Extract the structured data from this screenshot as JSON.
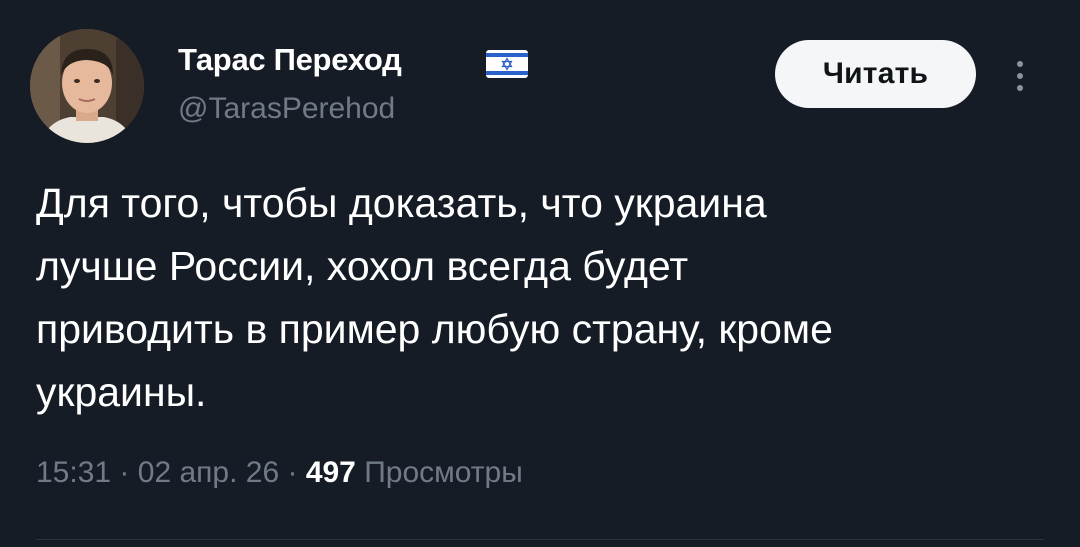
{
  "tweet": {
    "author": {
      "display_name": "Тарас Переход",
      "handle": "@TarasPerehod",
      "flag_icon": "israel-flag-icon",
      "avatar_icon": "profile-avatar"
    },
    "follow_button": "Читать",
    "more_icon": "more-vertical-icon",
    "text_lines": [
      "Для того, чтобы доказать, что украина",
      "лучше России, хохол всегда будет",
      "приводить в пример любую страну, кроме",
      "украины."
    ],
    "time": "15:31",
    "date": "02 апр. 26",
    "separator": "·",
    "views_count": "497",
    "views_label": "Просмотры"
  },
  "colors": {
    "background": "#161c26",
    "text": "#ffffff",
    "secondary_text": "#717b87",
    "button_bg": "#f5f6f7",
    "button_text": "#0f1419"
  }
}
